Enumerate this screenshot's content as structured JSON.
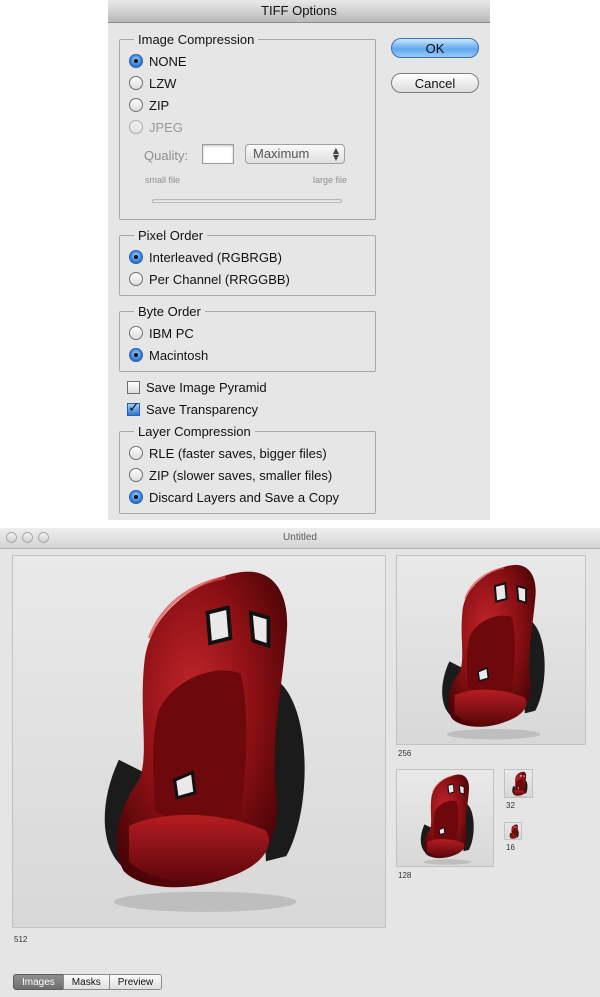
{
  "dialog": {
    "title": "TIFF Options",
    "ok_label": "OK",
    "cancel_label": "Cancel",
    "image_compression": {
      "legend": "Image Compression",
      "options": [
        {
          "label": "NONE",
          "selected": true,
          "enabled": true
        },
        {
          "label": "LZW",
          "selected": false,
          "enabled": true
        },
        {
          "label": "ZIP",
          "selected": false,
          "enabled": true
        },
        {
          "label": "JPEG",
          "selected": false,
          "enabled": false
        }
      ],
      "quality_label": "Quality:",
      "quality_value": "",
      "quality_preset": "Maximum",
      "small_file_label": "small file",
      "large_file_label": "large file"
    },
    "pixel_order": {
      "legend": "Pixel Order",
      "options": [
        {
          "label": "Interleaved (RGBRGB)",
          "selected": true
        },
        {
          "label": "Per Channel (RRGGBB)",
          "selected": false
        }
      ]
    },
    "byte_order": {
      "legend": "Byte Order",
      "options": [
        {
          "label": "IBM PC",
          "selected": false
        },
        {
          "label": "Macintosh",
          "selected": true
        }
      ]
    },
    "save_image_pyramid": {
      "label": "Save Image Pyramid",
      "checked": false
    },
    "save_transparency": {
      "label": "Save Transparency",
      "checked": true
    },
    "layer_compression": {
      "legend": "Layer Compression",
      "options": [
        {
          "label": "RLE (faster saves, bigger files)",
          "selected": false
        },
        {
          "label": "ZIP (slower saves, smaller files)",
          "selected": false
        },
        {
          "label": "Discard Layers and Save a Copy",
          "selected": true
        }
      ]
    }
  },
  "preview_window": {
    "title": "Untitled",
    "thumbnails": [
      {
        "size_label": "512",
        "icon": "racing-seat-image"
      },
      {
        "size_label": "256",
        "icon": "racing-seat-image"
      },
      {
        "size_label": "128",
        "icon": "racing-seat-image"
      },
      {
        "size_label": "32",
        "icon": "racing-seat-image"
      },
      {
        "size_label": "16",
        "icon": "racing-seat-image"
      }
    ],
    "tabs": [
      {
        "label": "Images",
        "active": true
      },
      {
        "label": "Masks",
        "active": false
      },
      {
        "label": "Preview",
        "active": false
      }
    ],
    "colors": {
      "seat_red": "#8c1014",
      "seat_dark": "#4a0407",
      "accent_blue": "#3b86e0"
    }
  }
}
